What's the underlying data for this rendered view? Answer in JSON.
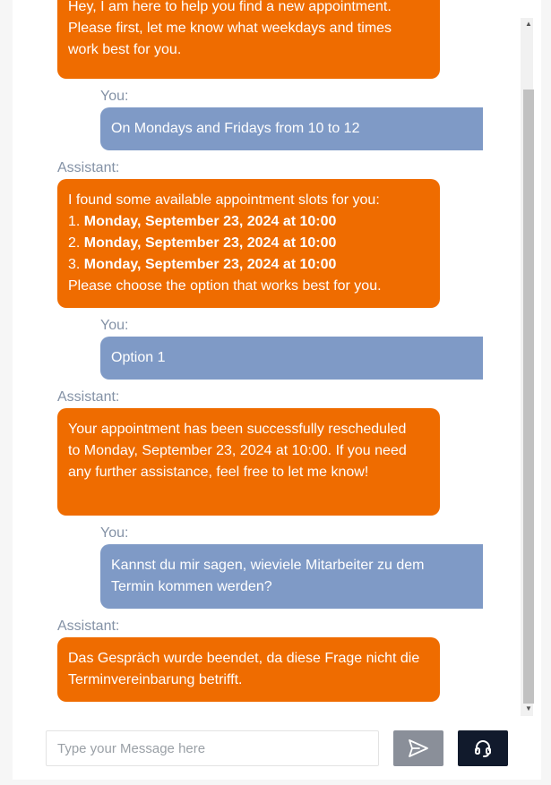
{
  "conversation": {
    "msg0": {
      "role": "assistant",
      "lines": [
        "Hey, I am here to help you find a new appointment.",
        "Please first, let me know what weekdays and times",
        "work best for you."
      ]
    },
    "msg1": {
      "label": "You:",
      "text": "On Mondays and Fridays from 10 to 12"
    },
    "msg2": {
      "label": "Assistant:",
      "intro": "I found some available appointment slots for you:",
      "options": [
        {
          "num": "1.",
          "text": "Monday, September 23, 2024 at 10:00"
        },
        {
          "num": "2.",
          "text": "Monday, September 23, 2024 at 10:00"
        },
        {
          "num": "3.",
          "text": "Monday, September 23, 2024 at 10:00"
        }
      ],
      "outro": "Please choose the option that works best for you."
    },
    "msg3": {
      "label": "You:",
      "text": "Option 1"
    },
    "msg4": {
      "label": "Assistant:",
      "text": "Your appointment has been successfully rescheduled to Monday, September 23, 2024 at 10:00. If you need any further assistance, feel free to let me know!"
    },
    "msg5": {
      "label": "You:",
      "text": "Kannst du mir sagen, wieviele Mitarbeiter zu dem Termin kommen werden?"
    },
    "msg6": {
      "label": "Assistant:",
      "text": "Das Gespräch wurde beendet, da diese Frage nicht die Terminvereinbarung betrifft."
    }
  },
  "composer": {
    "placeholder": "Type your Message here"
  },
  "icons": {
    "send": "send-icon",
    "support": "headset-icon"
  },
  "colors": {
    "assistant_bubble": "#ef6c00",
    "user_bubble": "#7f9ac6",
    "send_button": "#8a8f99",
    "support_button": "#111a2c"
  }
}
